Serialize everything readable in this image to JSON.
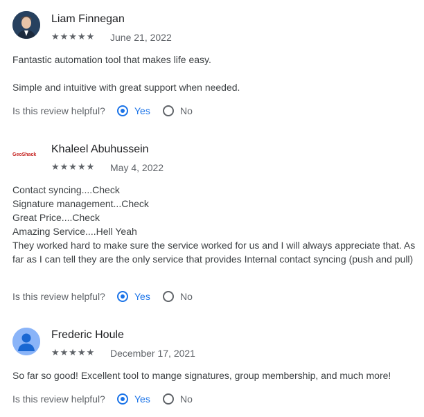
{
  "helpful_question": "Is this review helpful?",
  "yes_label": "Yes",
  "no_label": "No",
  "stars_glyph": "★★★★★",
  "reviews": [
    {
      "author": "Liam Finnegan",
      "rating": 5,
      "date": "June 21, 2022",
      "body": [
        "Fantastic automation tool that makes life easy.",
        "",
        "Simple and intuitive with great support when needed."
      ],
      "helpful": "Yes"
    },
    {
      "author": "Khaleel Abuhussein",
      "avatar_logo": "GeoShack",
      "rating": 5,
      "date": "May 4, 2022",
      "body": [
        "Contact syncing....Check",
        "Signature management...Check",
        "Great Price....Check",
        "Amazing Service....Hell Yeah",
        "They worked hard to make sure the service worked for us and I will always appreciate that. As far as I can tell they are the only service that provides Internal contact syncing (push and pull)"
      ],
      "helpful": "Yes"
    },
    {
      "author": "Frederic Houle",
      "rating": 5,
      "date": "December 17, 2021",
      "body": [
        "So far so good! Excellent tool to mange signatures, group membership, and much more!"
      ],
      "helpful": "Yes"
    }
  ],
  "colors": {
    "accent": "#1a73e8",
    "text": "#202124",
    "muted": "#5f6368",
    "avatar_blue": "#8ab4f8"
  }
}
